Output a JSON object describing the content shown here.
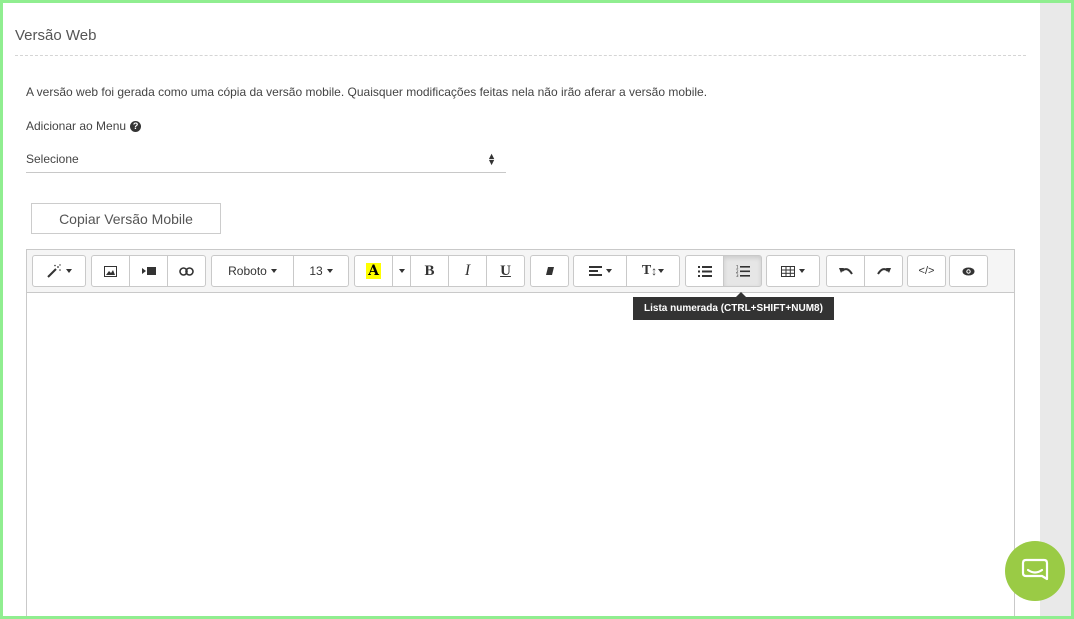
{
  "section": {
    "title": "Versão Web",
    "info": "A versão web foi gerada como uma cópia da versão mobile. Quaisquer modificações feitas nela não irão aferar a versão mobile."
  },
  "menu": {
    "label": "Adicionar ao Menu",
    "help_icon": "question-circle-icon",
    "select_value": "Selecione"
  },
  "copy_button": {
    "label": "Copiar Versão Mobile"
  },
  "toolbar": {
    "font_name": "Roboto",
    "font_size": "13",
    "highlight_letter": "A",
    "bold": "B",
    "italic": "I",
    "underline": "U",
    "text_height": "T",
    "code": "</>"
  },
  "tooltip": {
    "text": "Lista numerada (CTRL+SHIFT+NUM8)"
  },
  "colors": {
    "frame": "#90ee90",
    "highlight": "#ffff00",
    "chat": "#9acb45",
    "tooltip_bg": "#333333"
  }
}
